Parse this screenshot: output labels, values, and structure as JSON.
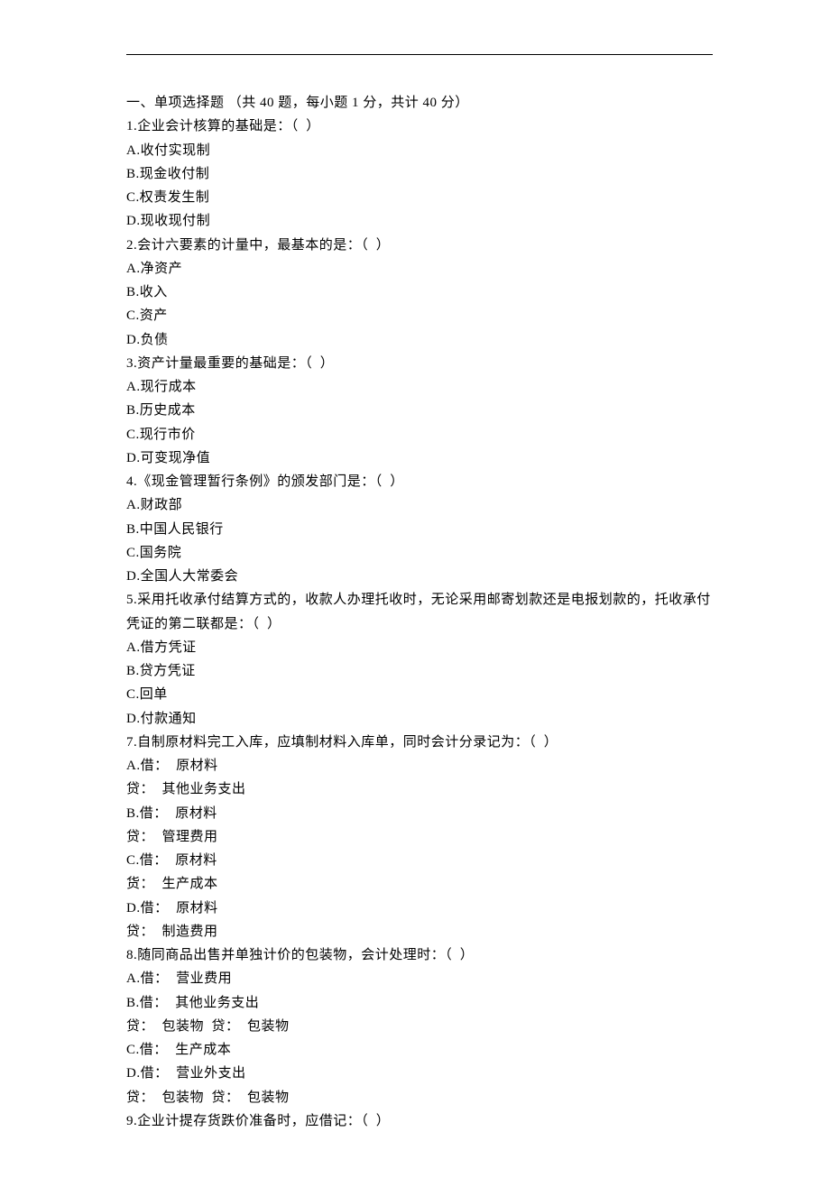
{
  "lines": [
    "一、单项选择题 （共 40 题，每小题 1 分，共计 40 分）",
    "1.企业会计核算的基础是：（  ）",
    "A.收付实现制",
    "B.现金收付制",
    "C.权责发生制",
    "D.现收现付制",
    "2.会计六要素的计量中，最基本的是：（  ）",
    "A.净资产",
    "B.收入",
    "C.资产",
    "D.负债",
    "3.资产计量最重要的基础是：（  ）",
    "A.现行成本",
    "B.历史成本",
    "C.现行市价",
    "D.可变现净值",
    "4.《现金管理暂行条例》的颁发部门是：（  ）",
    "A.财政部",
    "B.中国人民银行",
    "C.国务院",
    "D.全国人大常委会",
    "5.采用托收承付结算方式的，收款人办理托收时，无论采用邮寄划款还是电报划款的，托收承付凭证的第二联都是：（  ）",
    "A.借方凭证",
    "B.贷方凭证",
    "C.回单",
    "D.付款通知",
    "7.自制原材料完工入库，应填制材料入库单，同时会计分录记为：（  ）",
    "A.借：  原材料",
    "贷：  其他业务支出",
    "B.借：  原材料",
    "贷：  管理费用",
    "C.借：  原材料",
    "货：  生产成本",
    "D.借：  原材料",
    "贷：  制造费用",
    "8.随同商品出售并单独计价的包装物，会计处理时：（  ）",
    "A.借：  营业费用",
    "B.借：  其他业务支出",
    "贷：  包装物  贷：  包装物",
    "C.借：  生产成本",
    "D.借：  营业外支出",
    "贷：  包装物  贷：  包装物",
    "9.企业计提存货跌价准备时，应借记：（  ）"
  ]
}
